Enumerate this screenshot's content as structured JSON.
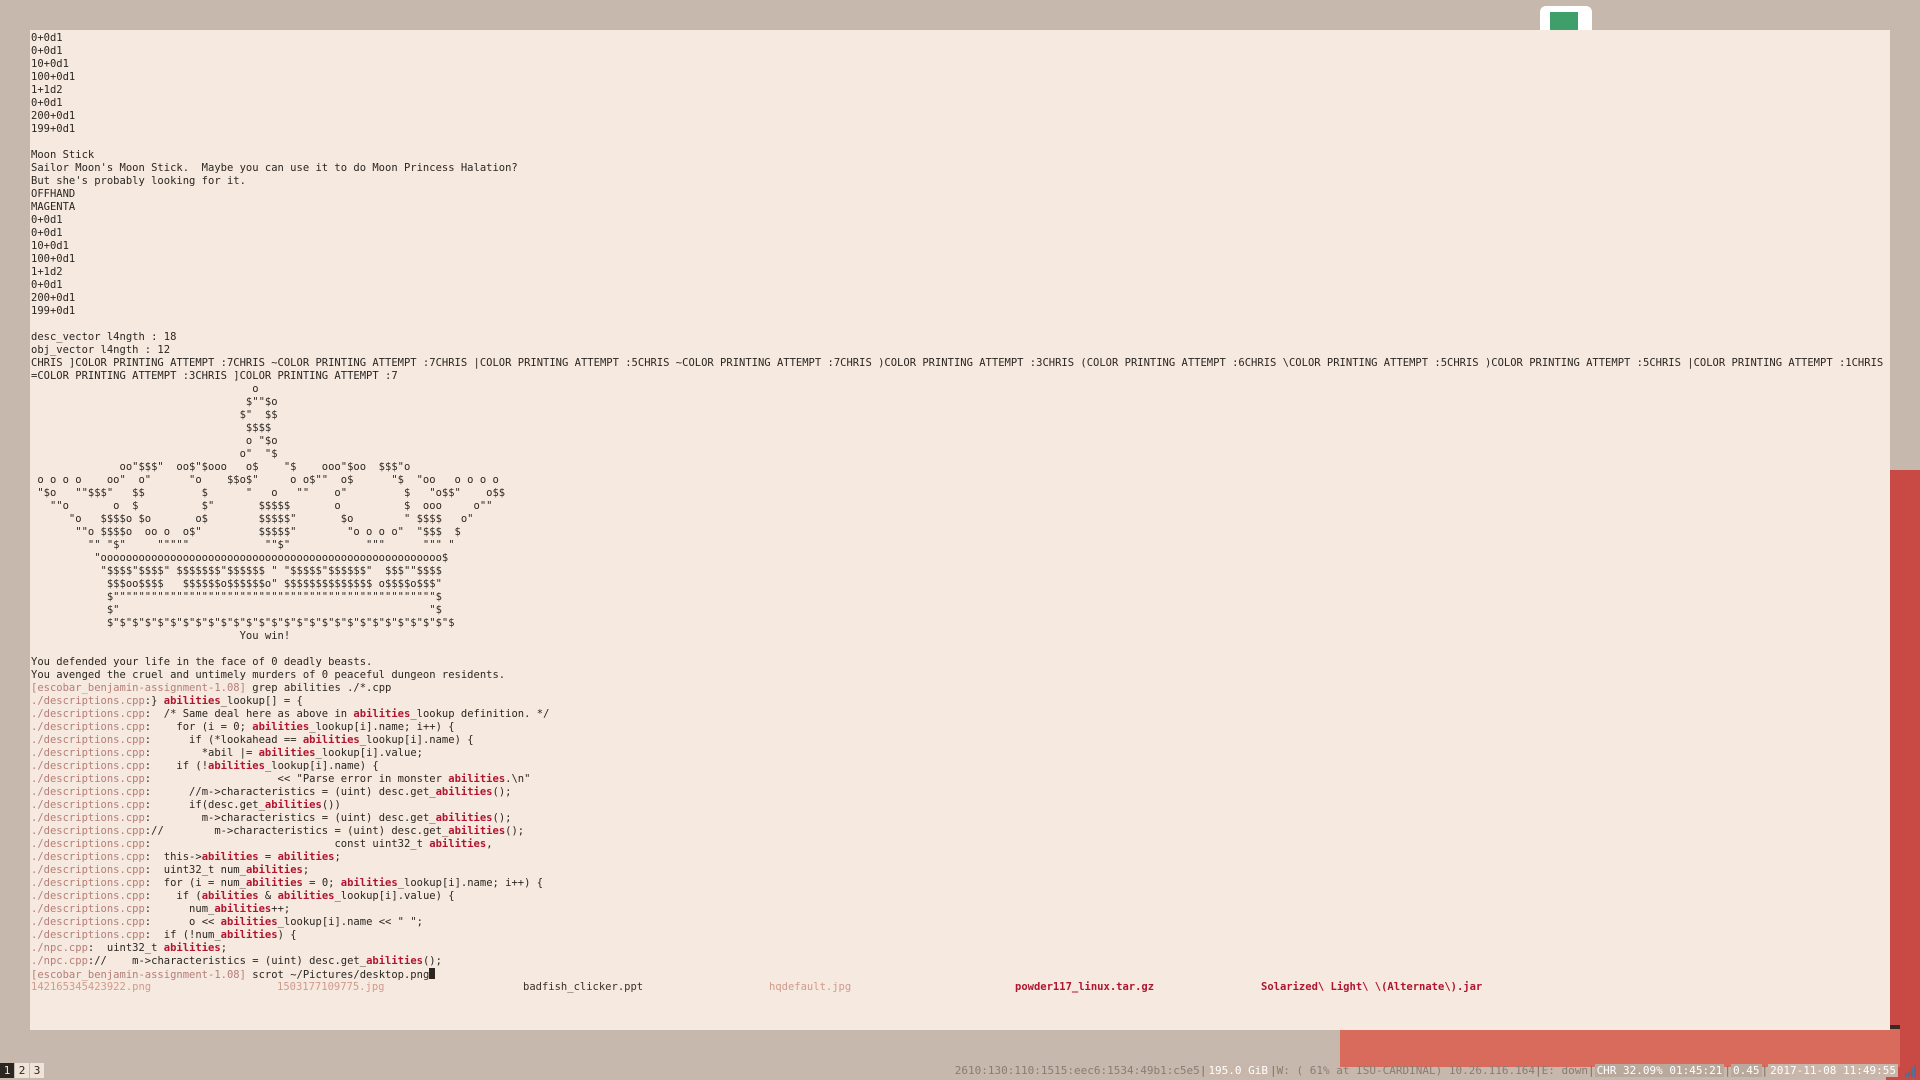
{
  "terminal": {
    "lines_top": [
      "0+0d1",
      "0+0d1",
      "10+0d1",
      "100+0d1",
      "1+1d2",
      "0+0d1",
      "200+0d1",
      "199+0d1",
      "",
      "Moon Stick",
      "Sailor Moon's Moon Stick.  Maybe you can use it to do Moon Princess Halation?",
      "But she's probably looking for it.",
      "OFFHAND",
      "MAGENTA",
      "0+0d1",
      "0+0d1",
      "10+0d1",
      "100+0d1",
      "1+1d2",
      "0+0d1",
      "200+0d1",
      "199+0d1",
      "",
      "desc_vector l4ngth : 18",
      "obj_vector l4ngth : 12"
    ],
    "wrapped_line": "CHRIS ]COLOR PRINTING ATTEMPT :7CHRIS ~COLOR PRINTING ATTEMPT :7CHRIS |COLOR PRINTING ATTEMPT :5CHRIS ~COLOR PRINTING ATTEMPT :7CHRIS )COLOR PRINTING ATTEMPT :3CHRIS (COLOR PRINTING ATTEMPT :6CHRIS \\COLOR PRINTING ATTEMPT :5CHRIS )COLOR PRINTING ATTEMPT :5CHRIS |COLOR PRINTING ATTEMPT :1CHRIS =COLOR PRINTING ATTEMPT :3CHRIS ]COLOR PRINTING ATTEMPT :7",
    "ascii_art": [
      "                                   o",
      "                                  $\"\"$o",
      "                                 $\"  $$",
      "                                  $$$$",
      "                                  o \"$o",
      "                                 o\"  \"$",
      "              oo\"$$$\"  oo$\"$ooo   o$    \"$    ooo\"$oo  $$$\"o",
      " o o o o    oo\"  o\"      \"o    $$o$\"     o o$\"\"  o$      \"$  \"oo   o o o o",
      " \"$o   \"\"$$$\"   $$         $      \"   o   \"\"    o\"         $   \"o$$\"    o$$",
      "   \"\"o       o  $          $\"       $$$$$       o          $  ooo     o\"\"",
      "      \"o   $$$$o $o       o$        $$$$$\"       $o        \" $$$$   o\"",
      "       \"\"o $$$$o  oo o  o$\"         $$$$$\"        \"o o o o\"  \"$$$  $",
      "         \"\" \"$\"     \"\"\"\"\"            \"\"$\"            \"\"\"      \"\"\" \"",
      "          \"oooooooooooooooooooooooooooooooooooooooooooooooooooooo$",
      "           \"$$$$\"$$$$\" $$$$$$$\"$$$$$$ \" \"$$$$$\"$$$$$$\"  $$$\"\"$$$$",
      "            $$$oo$$$$   $$$$$$o$$$$$$o\" $$$$$$$$$$$$$$ o$$$$o$$$\"",
      "            $\"\"\"\"\"\"\"\"\"\"\"\"\"\"\"\"\"\"\"\"\"\"\"\"\"\"\"\"\"\"\"\"\"\"\"\"\"\"\"\"\"\"\"\"\"\"\"\"\"\"\"$",
      "            $\"                                                 \"$",
      "            $\"$\"$\"$\"$\"$\"$\"$\"$\"$\"$\"$\"$\"$\"$\"$\"$\"$\"$\"$\"$\"$\"$\"$\"$\"$\"$\"$",
      "                                 You win!"
    ],
    "lines_after_art": [
      "",
      "You defended your life in the face of 0 deadly beasts.",
      "You avenged the cruel and untimely murders of 0 peaceful dungeon residents."
    ],
    "prompt": "[escobar_benjamin-assignment-1.08]",
    "command1": " grep abilities ./*.cpp",
    "grep_results": [
      {
        "file": "./descriptions.cpp",
        "parts": [
          [
            "} ",
            0
          ],
          [
            "abilities",
            1
          ],
          [
            "_lookup[] = {",
            0
          ]
        ]
      },
      {
        "file": "./descriptions.cpp",
        "parts": [
          [
            "  /* Same deal here as above in ",
            0
          ],
          [
            "abilities",
            1
          ],
          [
            "_lookup definition. */",
            0
          ]
        ]
      },
      {
        "file": "./descriptions.cpp",
        "parts": [
          [
            "    for (i = 0; ",
            0
          ],
          [
            "abilities",
            1
          ],
          [
            "_lookup[i].name; i++) {",
            0
          ]
        ]
      },
      {
        "file": "./descriptions.cpp",
        "parts": [
          [
            "      if (*lookahead == ",
            0
          ],
          [
            "abilities",
            1
          ],
          [
            "_lookup[i].name) {",
            0
          ]
        ]
      },
      {
        "file": "./descriptions.cpp",
        "parts": [
          [
            "        *abil |= ",
            0
          ],
          [
            "abilities",
            1
          ],
          [
            "_lookup[i].value;",
            0
          ]
        ]
      },
      {
        "file": "./descriptions.cpp",
        "parts": [
          [
            "    if (!",
            0
          ],
          [
            "abilities",
            1
          ],
          [
            "_lookup[i].name) {",
            0
          ]
        ]
      },
      {
        "file": "./descriptions.cpp",
        "parts": [
          [
            "                    << \"Parse error in monster ",
            0
          ],
          [
            "abilities",
            1
          ],
          [
            ".\\n\"",
            0
          ]
        ]
      },
      {
        "file": "./descriptions.cpp",
        "parts": [
          [
            "      //m->characteristics = (uint) desc.get_",
            0
          ],
          [
            "abilities",
            1
          ],
          [
            "();",
            0
          ]
        ]
      },
      {
        "file": "./descriptions.cpp",
        "parts": [
          [
            "      if(desc.get_",
            0
          ],
          [
            "abilities",
            1
          ],
          [
            "())",
            0
          ]
        ]
      },
      {
        "file": "./descriptions.cpp",
        "parts": [
          [
            "        m->characteristics = (uint) desc.get_",
            0
          ],
          [
            "abilities",
            1
          ],
          [
            "();",
            0
          ]
        ]
      },
      {
        "file": "./descriptions.cpp",
        "parts": [
          [
            "//        m->characteristics = (uint) desc.get_",
            0
          ],
          [
            "abilities",
            1
          ],
          [
            "();",
            0
          ]
        ]
      },
      {
        "file": "./descriptions.cpp",
        "parts": [
          [
            "                             const uint32_t ",
            0
          ],
          [
            "abilities",
            1
          ],
          [
            ",",
            0
          ]
        ]
      },
      {
        "file": "./descriptions.cpp",
        "parts": [
          [
            "  this->",
            0
          ],
          [
            "abilities",
            1
          ],
          [
            " = ",
            0
          ],
          [
            "abilities",
            1
          ],
          [
            ";",
            0
          ]
        ]
      },
      {
        "file": "./descriptions.cpp",
        "parts": [
          [
            "  uint32_t num_",
            0
          ],
          [
            "abilities",
            1
          ],
          [
            ";",
            0
          ]
        ]
      },
      {
        "file": "./descriptions.cpp",
        "parts": [
          [
            "  for (i = num_",
            0
          ],
          [
            "abilities",
            1
          ],
          [
            " = 0; ",
            0
          ],
          [
            "abilities",
            1
          ],
          [
            "_lookup[i].name; i++) {",
            0
          ]
        ]
      },
      {
        "file": "./descriptions.cpp",
        "parts": [
          [
            "    if (",
            0
          ],
          [
            "abilities",
            1
          ],
          [
            " & ",
            0
          ],
          [
            "abilities",
            1
          ],
          [
            "_lookup[i].value) {",
            0
          ]
        ]
      },
      {
        "file": "./descriptions.cpp",
        "parts": [
          [
            "      num_",
            0
          ],
          [
            "abilities",
            1
          ],
          [
            "++;",
            0
          ]
        ]
      },
      {
        "file": "./descriptions.cpp",
        "parts": [
          [
            "      o << ",
            0
          ],
          [
            "abilities",
            1
          ],
          [
            "_lookup[i].name << \" \";",
            0
          ]
        ]
      },
      {
        "file": "./descriptions.cpp",
        "parts": [
          [
            "  if (!num_",
            0
          ],
          [
            "abilities",
            1
          ],
          [
            ") {",
            0
          ]
        ]
      },
      {
        "file": "./npc.cpp",
        "parts": [
          [
            "  uint32_t ",
            0
          ],
          [
            "abilities",
            1
          ],
          [
            ";",
            0
          ]
        ]
      },
      {
        "file": "./npc.cpp",
        "parts": [
          [
            "//    m->characteristics = (uint) desc.get_",
            0
          ],
          [
            "abilities",
            1
          ],
          [
            "();",
            0
          ]
        ]
      }
    ],
    "command2": " scrot ~/Pictures/desktop.png",
    "completions": [
      {
        "name": "1421653454239​22.png",
        "style": "dim"
      },
      {
        "name": "1503177109775.jpg",
        "style": "dim"
      },
      {
        "name": "badfish_clicker.ppt",
        "style": "dark"
      },
      {
        "name": "hqdefault.jpg",
        "style": "dim"
      },
      {
        "name": "powder117_linux.tar.gz",
        "style": "red"
      },
      {
        "name": "Solarized\\ Light\\ \\(Alternate\\).jar",
        "style": "red"
      }
    ]
  },
  "statusbar": {
    "workspaces": [
      "1",
      "2",
      "3"
    ],
    "active_workspace": "1",
    "ipv6": "2610:130:110:1515:eec6:1534:49b1:c5e5",
    "disk": "195.0 GiB",
    "wifi": "W: ( 61% at ISU-CARDINAL) 10.26.116.164",
    "ethernet": "E: down",
    "battery": "CHR 32.09% 01:45:21",
    "load": "0.45",
    "datetime": "2017-11-08 11:49:55"
  },
  "colors": {
    "desktop": "#c7b8ad",
    "terminal_bg": "#f6e9df",
    "text": "#2b2622",
    "highlight": "#b01530",
    "filename": "#b57e78"
  }
}
